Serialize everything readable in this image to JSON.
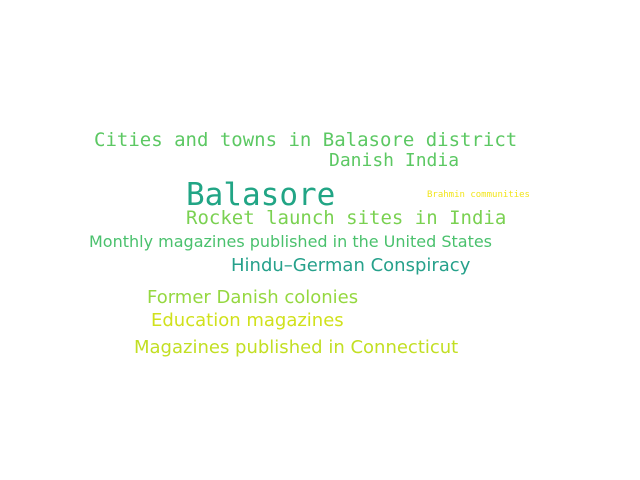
{
  "words": [
    {
      "text": "Cities and towns in Balasore district",
      "color": "#5cc863"
    },
    {
      "text": "Danish India",
      "color": "#5cc863"
    },
    {
      "text": "Balasore",
      "color": "#21a585"
    },
    {
      "text": "Brahmin communities",
      "color": "#f2e51d"
    },
    {
      "text": "Rocket launch sites in India",
      "color": "#7ad151"
    },
    {
      "text": "Monthly magazines published in the United States",
      "color": "#4ac16d"
    },
    {
      "text": "Hindu–German Conspiracy",
      "color": "#26a18b"
    },
    {
      "text": "Former Danish colonies",
      "color": "#95d840"
    },
    {
      "text": "Education magazines",
      "color": "#d0e11c"
    },
    {
      "text": "Magazines published in Connecticut",
      "color": "#c2df23"
    }
  ]
}
